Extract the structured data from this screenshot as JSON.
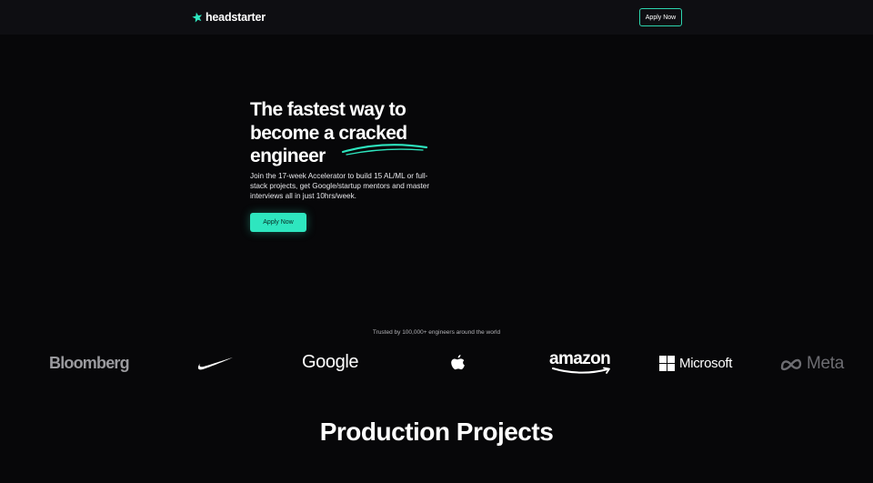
{
  "nav": {
    "logo_text": "headstarter",
    "apply_label": "Apply Now"
  },
  "hero": {
    "title_lines": [
      "The fastest way to",
      "become a cracked",
      "engineer"
    ],
    "subtitle": "Join the 17-week Accelerator to build 15 AL/ML or full-stack projects, get Google/startup mentors and master interviews all in just 10hrs/week.",
    "apply_label": "Apply Now"
  },
  "trusted": {
    "caption": "Trusted by 100,000+ engineers around the world",
    "logos": {
      "bloomberg": "Bloomberg",
      "nike": "nike-swoosh",
      "google": "Google",
      "apple": "apple-logo",
      "amazon": "amazon",
      "microsoft": "Microsoft",
      "meta": "Meta"
    }
  },
  "sections": {
    "projects_title": "Production Projects"
  },
  "colors": {
    "accent": "#2ee6bf",
    "background": "#070709",
    "navbar": "#0e0e12"
  }
}
